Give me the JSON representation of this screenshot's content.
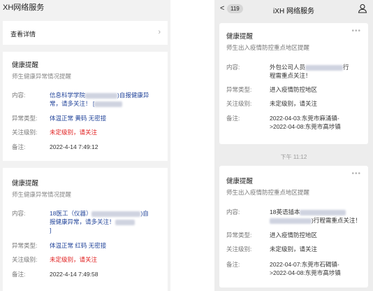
{
  "left": {
    "app_title": "XH网络服务",
    "detail_label": "查看详情",
    "cards": [
      {
        "title": "健康提醒",
        "subtitle": "师生健康异常情况提醒",
        "content_label": "内容:",
        "content_prefix": "信息科学学院",
        "content_suffix": ")自报健康异",
        "content_line2": "常，请多关注！ [",
        "type_label": "异常类型:",
        "type_value": "体温正常 黄码 无密接",
        "level_label": "关注级别:",
        "level_value": "未定级别，请关注",
        "note_label": "备注:",
        "note_value": "2022-4-14 7:49:12"
      },
      {
        "title": "健康提醒",
        "subtitle": "师生健康异常情况提醒",
        "content_label": "内容:",
        "content_prefix": "18医工（仪器）",
        "content_suffix": ")自",
        "content_line2": "报健康异常，请多关注！",
        "content_line3": "]",
        "type_label": "异常类型:",
        "type_value": "体温正常 红码 无密接",
        "level_label": "关注级别:",
        "level_value": "未定级别，请关注",
        "note_label": "备注:",
        "note_value": "2022-4-14 7:49:58"
      }
    ]
  },
  "right": {
    "back_glyph": "<",
    "badge": "119",
    "title": "iXH 网络服务",
    "time_separator": "下午 11:12",
    "cards": [
      {
        "title": "健康提醒",
        "subtitle": "师生出入疫情防控重点地区提醒",
        "content_label": "内容:",
        "content_line1_prefix": "外包公司人员",
        "content_line1_suffix": "行",
        "content_line2": "程需重点关注！",
        "type_label": "异常类型:",
        "type_value": "进入疫情防控地区",
        "level_label": "关注级别:",
        "level_value": "未定级别，请关注",
        "note_label": "备注:",
        "note_line1": "2022-04-03:东莞市麻涌镇-",
        "note_line2": ">2022-04-08:东莞市高埗镇"
      },
      {
        "title": "健康提醒",
        "subtitle": "师生出入疫情防控重点地区提醒",
        "content_label": "内容:",
        "content_line1_prefix": "18英语插本",
        "content_line1_suffix": "",
        "content_line2_suffix": ")行程需重点关注！",
        "type_label": "异常类型:",
        "type_value": "进入疫情防控地区",
        "level_label": "关注级别:",
        "level_value": "未定级别，请关注",
        "note_label": "备注:",
        "note_line1": "2022-04-07:东莞市石碣镇-",
        "note_line2": ">2022-04-08:东莞市高埗镇"
      }
    ]
  },
  "icons": [
    "chevron-right-icon",
    "back-arrow-icon",
    "user-icon",
    "more-icon"
  ],
  "colors": {
    "blue_text": "#22449a",
    "red_text": "#e02020",
    "muted": "#777777"
  }
}
